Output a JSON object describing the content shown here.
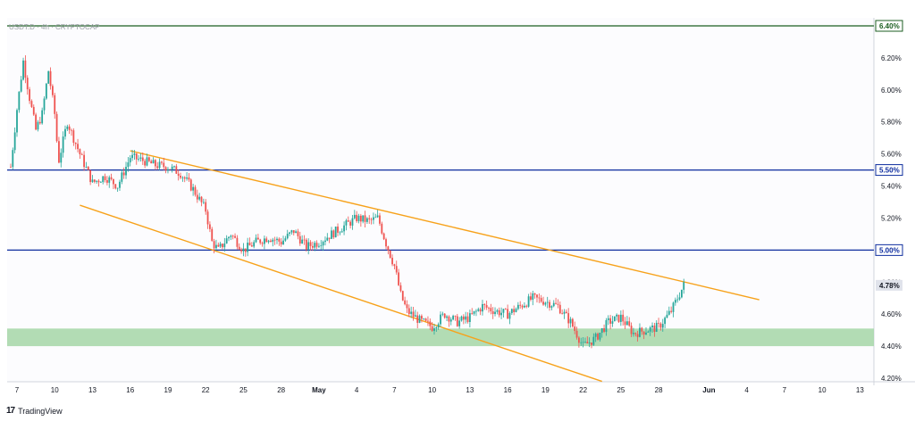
{
  "header": {
    "symbol_label": "USDT.D · 4h · CRYPTOCAP"
  },
  "footer": {
    "brand_logo": "17",
    "brand_name": "TradingView"
  },
  "colors": {
    "bull": "#26a69a",
    "bear": "#ef5350",
    "channel": "#f7a21b",
    "level": "#0d2c9e",
    "top_level": "#1b5e20",
    "support_zone": "#a5d6a7"
  },
  "chart_data": {
    "type": "candlestick",
    "title": "USDT.D · 4h · CRYPTOCAP",
    "ylim": [
      4.2,
      6.4
    ],
    "y_ticks": [
      6.2,
      6.0,
      5.8,
      5.6,
      5.4,
      5.2,
      4.8,
      4.6,
      4.4,
      4.2
    ],
    "y_tick_labels": [
      "6.20%",
      "6.00%",
      "5.80%",
      "5.60%",
      "5.40%",
      "5.20%",
      "4.80%",
      "4.60%",
      "4.40%",
      "4.20%"
    ],
    "x_ticks": [
      {
        "label": "7",
        "day": 0
      },
      {
        "label": "10",
        "day": 3
      },
      {
        "label": "13",
        "day": 6
      },
      {
        "label": "16",
        "day": 9
      },
      {
        "label": "19",
        "day": 12
      },
      {
        "label": "22",
        "day": 15
      },
      {
        "label": "25",
        "day": 18
      },
      {
        "label": "28",
        "day": 21
      },
      {
        "label": "May",
        "day": 24
      },
      {
        "label": "4",
        "day": 27
      },
      {
        "label": "7",
        "day": 30
      },
      {
        "label": "10",
        "day": 33
      },
      {
        "label": "13",
        "day": 36
      },
      {
        "label": "16",
        "day": 39
      },
      {
        "label": "19",
        "day": 42
      },
      {
        "label": "22",
        "day": 45
      },
      {
        "label": "25",
        "day": 48
      },
      {
        "label": "28",
        "day": 51
      },
      {
        "label": "Jun",
        "day": 55
      },
      {
        "label": "4",
        "day": 58
      },
      {
        "label": "7",
        "day": 61
      },
      {
        "label": "10",
        "day": 64
      },
      {
        "label": "13",
        "day": 67
      }
    ],
    "horizontal_levels": [
      {
        "value": 6.4,
        "label": "6.40%"
      },
      {
        "value": 5.5,
        "label": "5.50%"
      },
      {
        "value": 5.0,
        "label": "5.00%"
      }
    ],
    "current_price": {
      "value": 4.78,
      "label": "4.78%"
    },
    "support_zone": {
      "low": 4.4,
      "high": 4.51
    },
    "trendlines": [
      {
        "name": "upper-channel",
        "start": {
          "day": 9.0,
          "value": 5.62
        },
        "end": {
          "day": 59.0,
          "value": 4.69
        }
      },
      {
        "name": "lower-channel",
        "start": {
          "day": 5.0,
          "value": 5.28
        },
        "end": {
          "day": 46.5,
          "value": 4.18
        }
      }
    ],
    "price_path": [
      {
        "day": -0.5,
        "value": 5.52
      },
      {
        "day": 0.0,
        "value": 5.88
      },
      {
        "day": 0.5,
        "value": 6.18
      },
      {
        "day": 1.0,
        "value": 5.95
      },
      {
        "day": 1.5,
        "value": 5.75
      },
      {
        "day": 2.0,
        "value": 5.85
      },
      {
        "day": 2.5,
        "value": 6.12
      },
      {
        "day": 3.0,
        "value": 5.85
      },
      {
        "day": 3.3,
        "value": 5.55
      },
      {
        "day": 4.0,
        "value": 5.8
      },
      {
        "day": 5.0,
        "value": 5.6
      },
      {
        "day": 6.0,
        "value": 5.42
      },
      {
        "day": 7.0,
        "value": 5.46
      },
      {
        "day": 8.0,
        "value": 5.4
      },
      {
        "day": 9.0,
        "value": 5.58
      },
      {
        "day": 10.0,
        "value": 5.56
      },
      {
        "day": 11.0,
        "value": 5.53
      },
      {
        "day": 12.0,
        "value": 5.52
      },
      {
        "day": 13.0,
        "value": 5.48
      },
      {
        "day": 14.0,
        "value": 5.38
      },
      {
        "day": 15.0,
        "value": 5.25
      },
      {
        "day": 15.5,
        "value": 5.05
      },
      {
        "day": 16.0,
        "value": 5.0
      },
      {
        "day": 17.0,
        "value": 5.1
      },
      {
        "day": 18.0,
        "value": 5.0
      },
      {
        "day": 19.0,
        "value": 5.05
      },
      {
        "day": 20.0,
        "value": 5.08
      },
      {
        "day": 21.0,
        "value": 5.05
      },
      {
        "day": 22.0,
        "value": 5.12
      },
      {
        "day": 23.0,
        "value": 5.02
      },
      {
        "day": 24.0,
        "value": 5.05
      },
      {
        "day": 25.0,
        "value": 5.1
      },
      {
        "day": 26.0,
        "value": 5.15
      },
      {
        "day": 27.0,
        "value": 5.2
      },
      {
        "day": 28.0,
        "value": 5.18
      },
      {
        "day": 28.7,
        "value": 5.2
      },
      {
        "day": 29.3,
        "value": 5.05
      },
      {
        "day": 30.0,
        "value": 4.9
      },
      {
        "day": 30.5,
        "value": 4.72
      },
      {
        "day": 31.0,
        "value": 4.62
      },
      {
        "day": 32.0,
        "value": 4.56
      },
      {
        "day": 33.0,
        "value": 4.52
      },
      {
        "day": 34.0,
        "value": 4.6
      },
      {
        "day": 35.0,
        "value": 4.55
      },
      {
        "day": 36.0,
        "value": 4.58
      },
      {
        "day": 37.0,
        "value": 4.65
      },
      {
        "day": 38.0,
        "value": 4.62
      },
      {
        "day": 39.0,
        "value": 4.6
      },
      {
        "day": 40.0,
        "value": 4.65
      },
      {
        "day": 41.0,
        "value": 4.7
      },
      {
        "day": 42.0,
        "value": 4.68
      },
      {
        "day": 43.0,
        "value": 4.65
      },
      {
        "day": 44.0,
        "value": 4.55
      },
      {
        "day": 45.0,
        "value": 4.4
      },
      {
        "day": 46.0,
        "value": 4.45
      },
      {
        "day": 47.0,
        "value": 4.55
      },
      {
        "day": 48.0,
        "value": 4.58
      },
      {
        "day": 49.0,
        "value": 4.48
      },
      {
        "day": 50.0,
        "value": 4.5
      },
      {
        "day": 51.0,
        "value": 4.52
      },
      {
        "day": 52.0,
        "value": 4.62
      },
      {
        "day": 52.5,
        "value": 4.7
      },
      {
        "day": 53.0,
        "value": 4.78
      }
    ]
  }
}
